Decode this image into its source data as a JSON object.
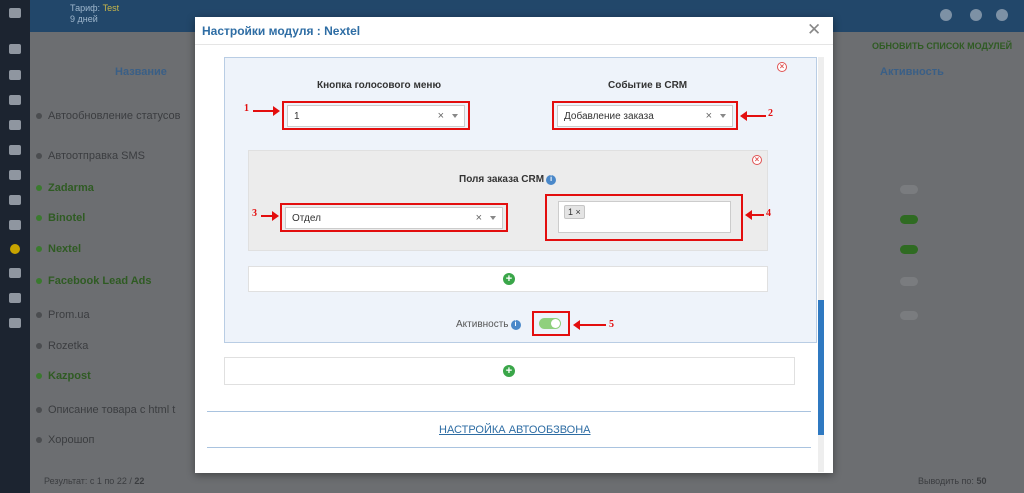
{
  "background": {
    "tariff_line1": "Тариф:",
    "tariff_name": "Test",
    "tariff_line2": "9 дней",
    "col_name": "Название",
    "col_activity": "Активность",
    "refresh_label": "ОБНОВИТЬ СПИСОК МОДУЛЕЙ",
    "rows": [
      {
        "label": "Автообновление статусов",
        "active": false
      },
      {
        "label": "Автоотправка SMS",
        "active": false
      },
      {
        "label": "Zadarma",
        "active": true
      },
      {
        "label": "Binotel",
        "active": true
      },
      {
        "label": "Nextel",
        "active": true
      },
      {
        "label": "Facebook Lead Ads",
        "active": true
      },
      {
        "label": "Prom.ua",
        "active": false
      },
      {
        "label": "Rozetka",
        "active": false
      },
      {
        "label": "Kazpost",
        "active": true
      },
      {
        "label": "Описание товара с html t",
        "active": false
      },
      {
        "label": "Хорошоп",
        "active": false
      }
    ],
    "footer_result": "Результат: с 1 по 22 /",
    "footer_total": "22",
    "footer_perpage": "Выводить по:",
    "footer_perpage_value": "50"
  },
  "modal": {
    "title": "Настройки модуля : Nextel",
    "voice_menu_label": "Кнопка голосового меню",
    "voice_menu_value": "1",
    "crm_event_label": "Событие в CRM",
    "crm_event_value": "Добавление заказа",
    "order_fields_label": "Поля заказа CRM",
    "order_field_value": "Отдел",
    "multi_tag": "1",
    "activity_label": "Активность",
    "autodial_link": "НАСТРОЙКА АВТООБЗВОНА"
  },
  "annotations": {
    "n1": "1",
    "n2": "2",
    "n3": "3",
    "n4": "4",
    "n5": "5"
  },
  "colors": {
    "accent_blue": "#2e6da4",
    "highlight_red": "#e30e0e",
    "add_green": "#3aa649"
  }
}
